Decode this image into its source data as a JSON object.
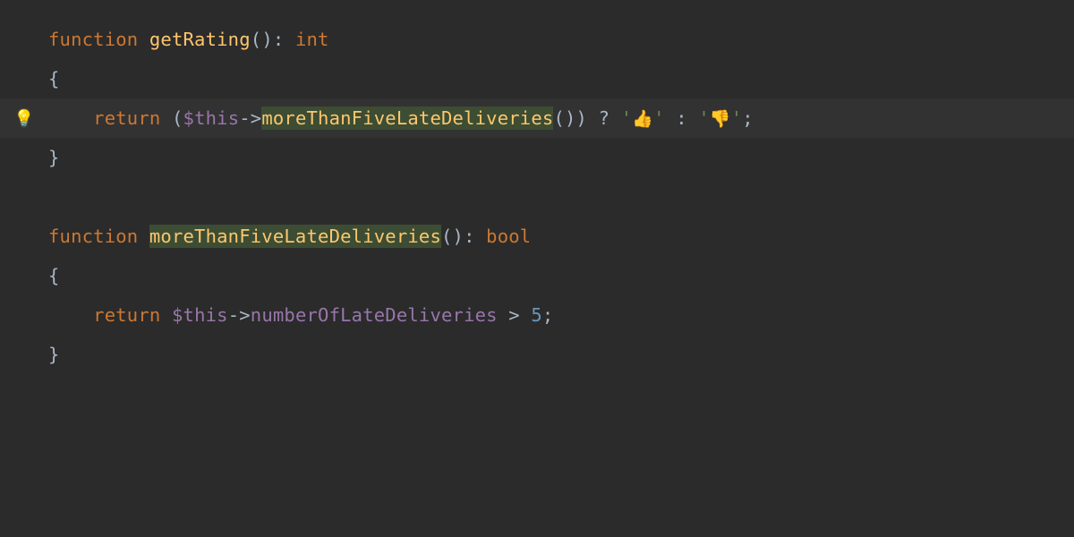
{
  "lines": {
    "l1": {
      "kw_function": "function",
      "fname": "getRating",
      "parens": "()",
      "colon": ":",
      "rtype": "int"
    },
    "l2": {
      "brace": "{"
    },
    "l3": {
      "kw_return": "return",
      "lparen": "(",
      "var_this": "$this",
      "arrow": "->",
      "method": "moreThanFiveLateDeliveries",
      "call_paren": "()",
      "rparen": ")",
      "qmark": "?",
      "q1a": "'",
      "emoji1": "👍",
      "q1b": "'",
      "colon_op": ":",
      "q2a": "'",
      "emoji2": "👎",
      "q2b": "'",
      "semi": ";"
    },
    "l4": {
      "brace": "}"
    },
    "l6": {
      "kw_function": "function",
      "fname": "moreThanFiveLateDeliveries",
      "parens": "()",
      "colon": ":",
      "rtype": "bool"
    },
    "l7": {
      "brace": "{"
    },
    "l8": {
      "kw_return": "return",
      "var_this": "$this",
      "arrow": "->",
      "prop": "numberOfLateDeliveries",
      "gt": ">",
      "num": "5",
      "semi": ";"
    },
    "l9": {
      "brace": "}"
    }
  },
  "bulb_icon": "💡"
}
